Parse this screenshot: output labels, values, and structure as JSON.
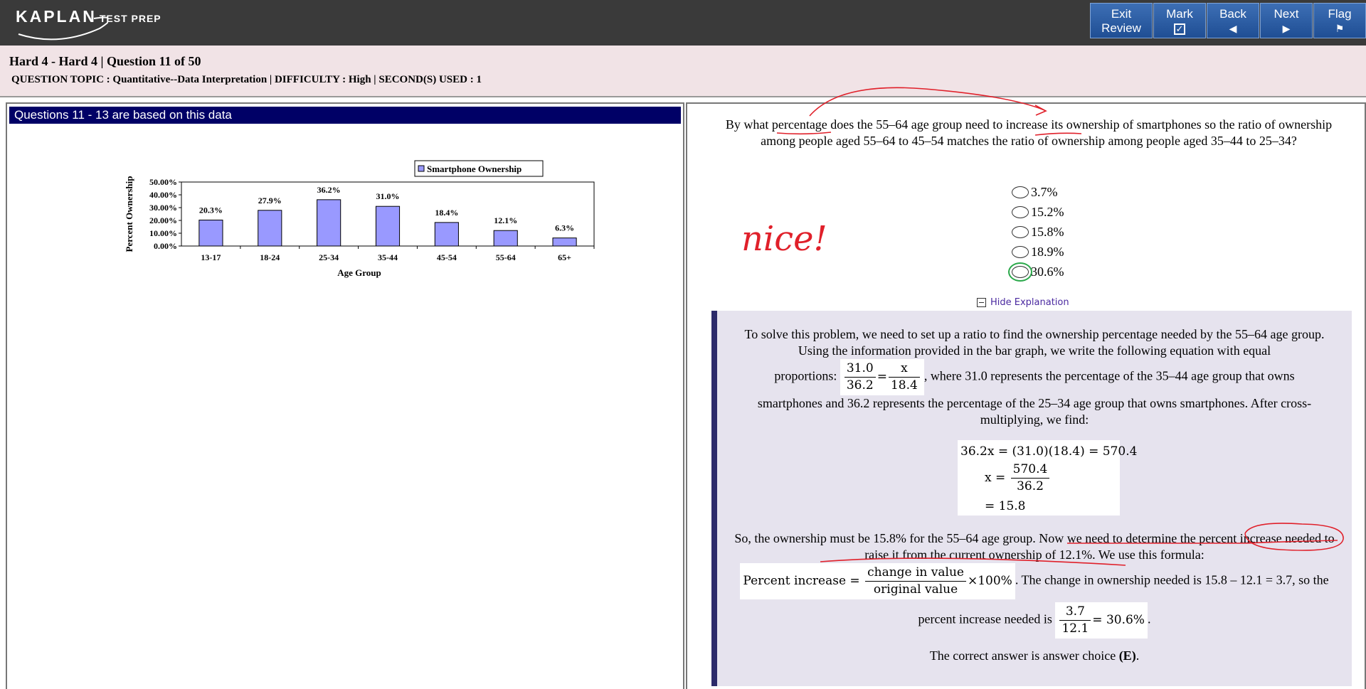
{
  "app": {
    "logo_word": "KAPLAN",
    "logo_sub": "TEST PREP"
  },
  "toolbar": {
    "exit_line1": "Exit",
    "exit_line2": "Review",
    "mark": "Mark",
    "back": "Back",
    "next": "Next",
    "flag": "Flag"
  },
  "header": {
    "title": "Hard 4 - Hard 4 | Question  11 of 50",
    "meta": "QUESTION TOPIC : Quantitative--Data Interpretation | DIFFICULTY : High | SECOND(S) USED : 1"
  },
  "left": {
    "banner": "Questions 11 - 13 are based on this data"
  },
  "chart_data": {
    "type": "bar",
    "categories": [
      "13-17",
      "18-24",
      "25-34",
      "35-44",
      "45-54",
      "55-64",
      "65+"
    ],
    "series": [
      {
        "name": "Smartphone Ownership",
        "values": [
          20.3,
          27.9,
          36.2,
          31.0,
          18.4,
          12.1,
          6.3
        ]
      }
    ],
    "data_labels": [
      "20.3%",
      "27.9%",
      "36.2%",
      "31.0%",
      "18.4%",
      "12.1%",
      "6.3%"
    ],
    "yticks": [
      "50.00%",
      "40.00%",
      "30.00%",
      "20.00%",
      "10.00%",
      "0.00%"
    ],
    "xlabel": "Age Group",
    "ylabel": "Percent Ownership",
    "ylim": [
      0,
      50
    ],
    "legend_position": "top-right",
    "bar_color": "#9999ff"
  },
  "question": {
    "text": "By what percentage does the 55–64 age group need to increase its ownership of smartphones so the ratio of ownership among people aged 55–64 to 45–54 matches the ratio of ownership among people aged 35–44 to 25–34?",
    "choices": [
      "3.7%",
      "15.2%",
      "15.8%",
      "18.9%",
      "30.6%"
    ],
    "selected_index": 4
  },
  "explanation": {
    "toggle": "Hide Explanation",
    "p1": "To solve this problem, we need to set up a ratio to find the ownership percentage needed by the 55–64 age group. Using the information provided in the bar graph, we write the following equation with equal",
    "p1b_pre": "proportions:",
    "p1b_post": ", where 31.0 represents the percentage of the 35–44 age group that owns",
    "p1c": "smartphones and 36.2 represents the percentage of the 25–34 age group that owns smartphones. After cross-multiplying, we find:",
    "ratio": {
      "num1": "31.0",
      "den1": "36.2",
      "eq": "=",
      "num2": "x",
      "den2": "18.4"
    },
    "eq1": "36.2x = (31.0)(18.4) = 570.4",
    "eq2_lhs": "x =",
    "eq2_num": "570.4",
    "eq2_den": "36.2",
    "eq3": "= 15.8",
    "p2": "So, the ownership must be 15.8% for the 55–64 age group. Now we need to determine the percent increase needed to raise it from the current ownership of 12.1%. We use this formula:",
    "formula_lhs": "Percent increase =",
    "formula_num": "change in value",
    "formula_den": "original value",
    "formula_rhs": "×100%",
    "p3_post": ". The change in ownership needed is 15.8 – 12.1 = 3.7, so the",
    "p4_pre": "percent increase needed is",
    "final_num": "3.7",
    "final_den": "12.1",
    "final_rhs": "= 30.6%",
    "p4_post": ".",
    "p5_pre": "The correct answer is answer choice ",
    "p5_bold": "(E)",
    "p5_post": "."
  },
  "annotation": {
    "handwriting": "nice!"
  }
}
